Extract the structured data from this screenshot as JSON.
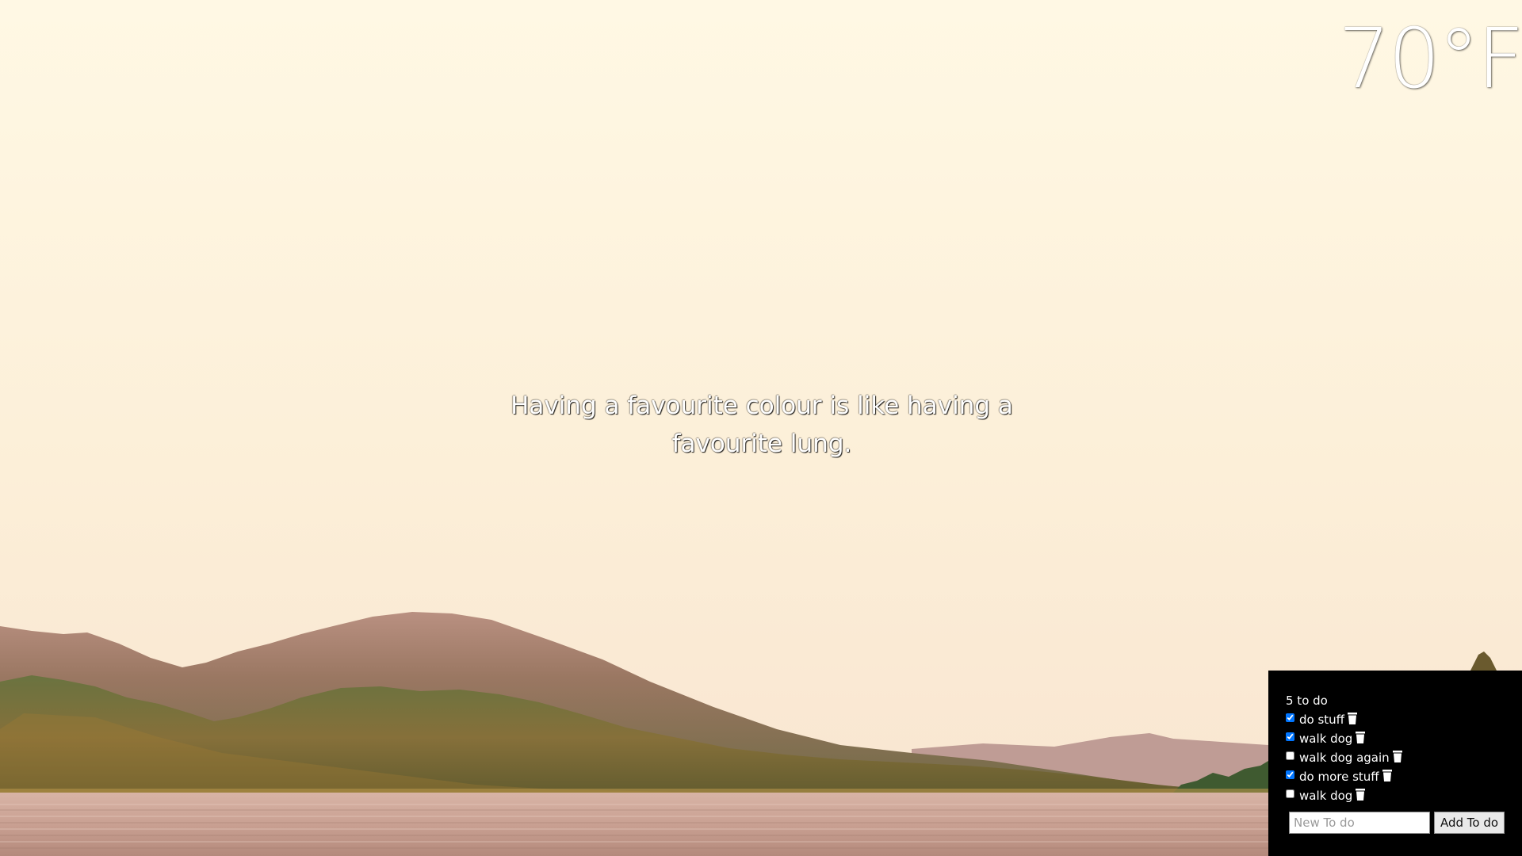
{
  "weather": {
    "temperature": "70°F"
  },
  "quote": {
    "text": "Having a favourite colour is like having a favourite lung."
  },
  "todo": {
    "count_label": "5 to do",
    "items": [
      {
        "label": "do stuff",
        "checked": true
      },
      {
        "label": "walk dog",
        "checked": true
      },
      {
        "label": "walk dog again",
        "checked": false
      },
      {
        "label": "do more stuff",
        "checked": true
      },
      {
        "label": "walk dog",
        "checked": false
      }
    ],
    "input_placeholder": "New To do",
    "add_button_label": "Add To do",
    "item_icon": "trash-icon"
  },
  "background": {
    "description_icon": "landscape-photo",
    "sky_color": "#fef8e3",
    "panel_color": "#000000"
  }
}
